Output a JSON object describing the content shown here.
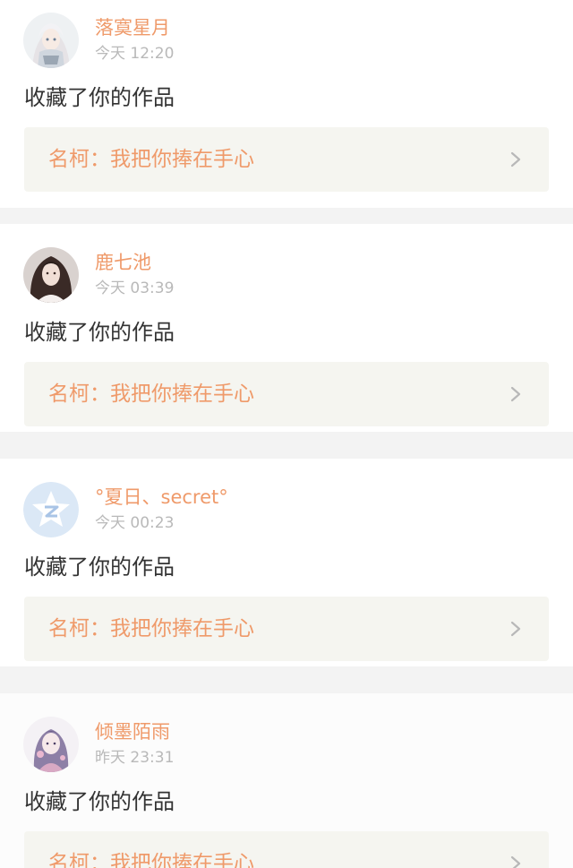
{
  "colors": {
    "accent": "#ef9a6a",
    "text": "#333333",
    "muted": "#b9b9b9",
    "card_bg": "#ffffff",
    "link_bg": "#f5f5f0",
    "divider_bg": "#f3f3f3"
  },
  "notifications": [
    {
      "avatar_icon": "user-avatar-icon",
      "username": "落寞星月",
      "time": "今天 12:20",
      "action": "收藏了你的作品",
      "work": "名柯：我把你捧在手心"
    },
    {
      "avatar_icon": "user-avatar-icon",
      "username": "鹿七池",
      "time": "今天 03:39",
      "action": "收藏了你的作品",
      "work": "名柯：我把你捧在手心"
    },
    {
      "avatar_icon": "default-qzone-avatar-icon",
      "username": "°夏日、secret°",
      "time": "今天 00:23",
      "action": "收藏了你的作品",
      "work": "名柯：我把你捧在手心"
    },
    {
      "avatar_icon": "user-avatar-icon",
      "username": "倾墨陌雨",
      "time": "昨天 23:31",
      "action": "收藏了你的作品",
      "work": "名柯：我把你捧在手心"
    }
  ]
}
